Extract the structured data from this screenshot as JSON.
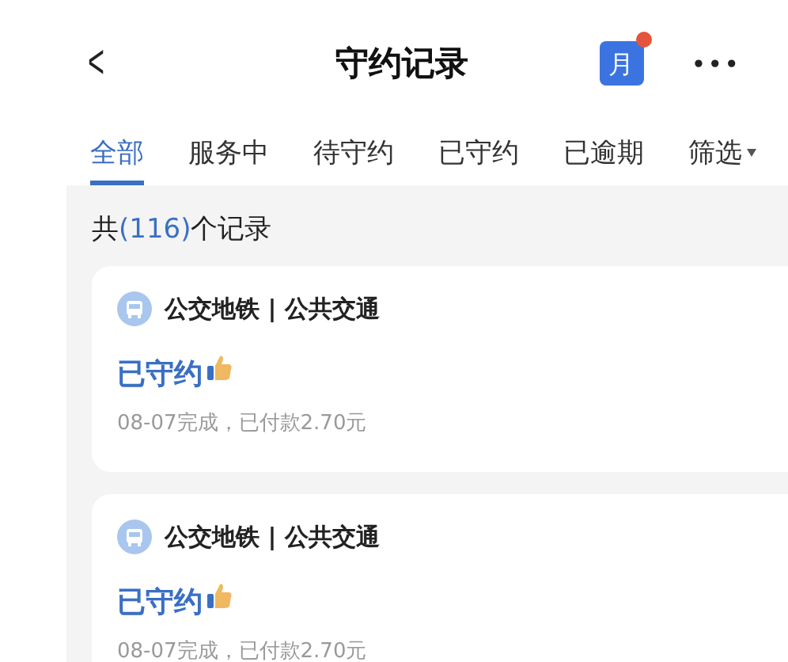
{
  "header": {
    "title": "守约记录",
    "calendar_label": "月",
    "calendar_badge": true,
    "more": "•••",
    "back": "<"
  },
  "tabs": [
    {
      "label": "全部",
      "selected": true
    },
    {
      "label": "服务中",
      "selected": false
    },
    {
      "label": "待守约",
      "selected": false
    },
    {
      "label": "已守约",
      "selected": false
    },
    {
      "label": "已逾期",
      "selected": false
    }
  ],
  "filter": {
    "label": "筛选"
  },
  "summary": {
    "prefix": "共",
    "count": "(116)",
    "suffix": "个记录"
  },
  "records": [
    {
      "category": "公交地铁 | 公共交通",
      "status": "已守约",
      "detail": "08-07完成，已付款2.70元"
    },
    {
      "category": "公交地铁 | 公共交通",
      "status": "已守约",
      "detail": "08-07完成，已付款2.70元"
    }
  ]
}
